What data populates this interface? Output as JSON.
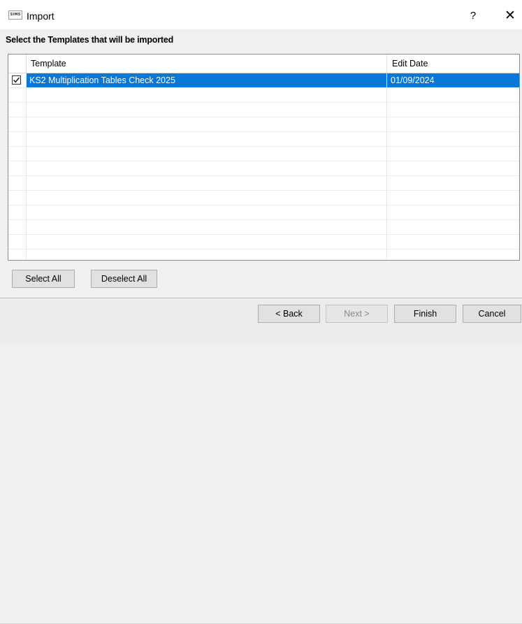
{
  "window": {
    "app_icon_text": "SIMS",
    "title": "Import",
    "help_glyph": "?",
    "close_glyph": "✕"
  },
  "heading": "Select the Templates that will be imported",
  "grid": {
    "columns": [
      "Template",
      "Edit Date"
    ],
    "rows": [
      {
        "checked": true,
        "template": "KS2 Multiplication Tables Check 2025",
        "edit_date": "01/09/2024",
        "selected": true
      }
    ]
  },
  "selection_buttons": {
    "select_all": "Select All",
    "deselect_all": "Deselect All"
  },
  "nav_buttons": {
    "back": "< Back",
    "next": "Next >",
    "finish": "Finish",
    "cancel": "Cancel"
  },
  "colors": {
    "selection": "#0a78d7"
  },
  "icons": {
    "app": "sims-app-icon",
    "help": "help-icon",
    "close": "close-icon",
    "checkbox": "checkmark-icon"
  }
}
